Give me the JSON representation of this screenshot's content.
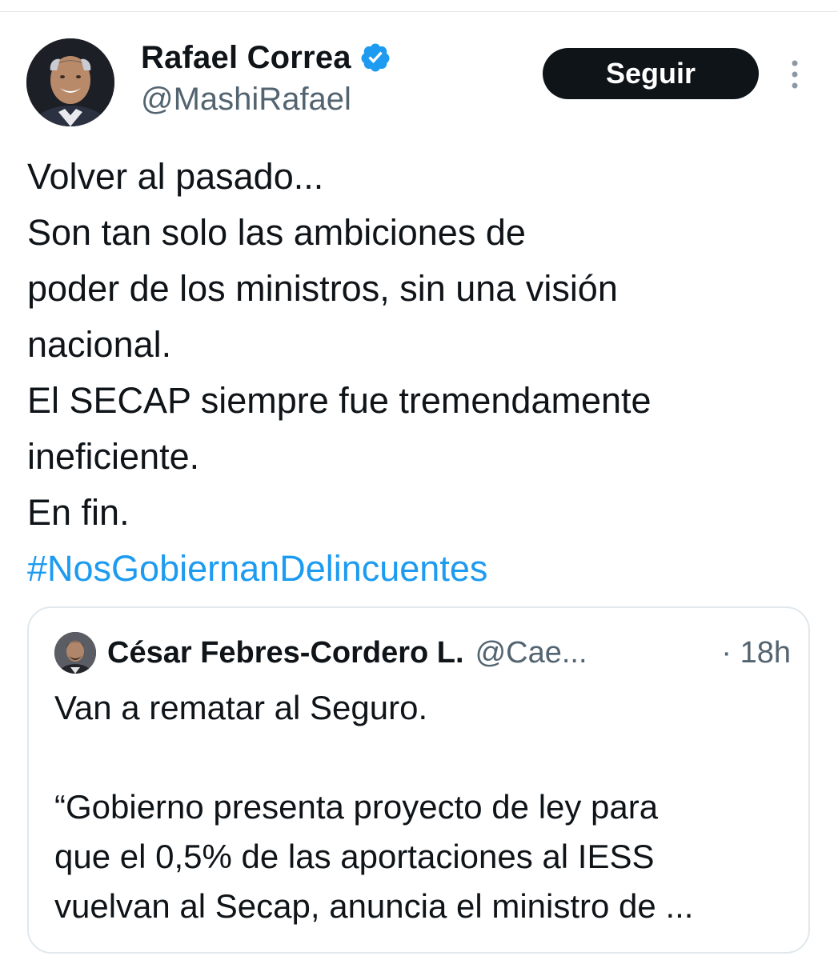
{
  "author": {
    "display_name": "Rafael Correa",
    "handle": "@MashiRafael",
    "verified": true
  },
  "actions": {
    "follow_label": "Seguir",
    "more_icon": "more-vertical-icon"
  },
  "tweet": {
    "lines": [
      "Volver al pasado...",
      "Son tan solo las ambiciones de",
      "poder de los ministros, sin una visión",
      "nacional.",
      "El SECAP siempre fue tremendamente",
      "ineficiente.",
      "En fin."
    ],
    "hashtag": "#NosGobiernanDelincuentes"
  },
  "quoted_tweet": {
    "display_name": "César Febres-Cordero L.",
    "handle": "@Cae...",
    "time": "· 18h",
    "lines": [
      "Van a rematar al Seguro.",
      "",
      "“Gobierno presenta proyecto de ley para",
      "que el 0,5% de las aportaciones al IESS",
      "vuelvan al Secap, anuncia el ministro de ..."
    ]
  },
  "colors": {
    "text": "#0f1419",
    "secondary": "#536471",
    "accent": "#1d9bf0",
    "button_bg": "#0f1419",
    "border": "#e1e8ed"
  }
}
